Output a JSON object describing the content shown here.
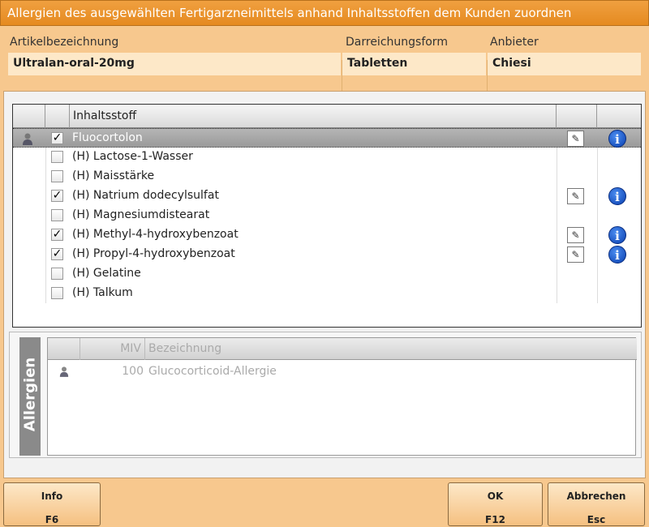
{
  "window": {
    "title": "Allergien des ausgewählten Fertigarzneimittels anhand Inhaltsstoffen dem Kunden zuordnen"
  },
  "artikel": {
    "headers": {
      "bezeichnung": "Artikelbezeichnung",
      "darreichung": "Darreichungsform",
      "anbieter": "Anbieter"
    },
    "values": {
      "bezeichnung": "Ultralan-oral-20mg",
      "darreichung": "Tabletten",
      "anbieter": "Chiesi"
    }
  },
  "inhaltsstoffe": {
    "column_header": "Inhaltsstoff",
    "rows": [
      {
        "name": "Fluocortolon",
        "checked": true,
        "selected": true,
        "person_icon": true,
        "pen_icon": true,
        "info_icon": true
      },
      {
        "name": "(H) Lactose-1-Wasser",
        "checked": false,
        "selected": false,
        "person_icon": false,
        "pen_icon": false,
        "info_icon": false
      },
      {
        "name": "(H) Maisstärke",
        "checked": false,
        "selected": false,
        "person_icon": false,
        "pen_icon": false,
        "info_icon": false
      },
      {
        "name": "(H) Natrium dodecylsulfat",
        "checked": true,
        "selected": false,
        "person_icon": false,
        "pen_icon": true,
        "info_icon": true
      },
      {
        "name": "(H) Magnesiumdistearat",
        "checked": false,
        "selected": false,
        "person_icon": false,
        "pen_icon": false,
        "info_icon": false
      },
      {
        "name": "(H) Methyl-4-hydroxybenzoat",
        "checked": true,
        "selected": false,
        "person_icon": false,
        "pen_icon": true,
        "info_icon": true
      },
      {
        "name": "(H) Propyl-4-hydroxybenzoat",
        "checked": true,
        "selected": false,
        "person_icon": false,
        "pen_icon": true,
        "info_icon": true
      },
      {
        "name": "(H) Gelatine",
        "checked": false,
        "selected": false,
        "person_icon": false,
        "pen_icon": false,
        "info_icon": false
      },
      {
        "name": "(H) Talkum",
        "checked": false,
        "selected": false,
        "person_icon": false,
        "pen_icon": false,
        "info_icon": false
      }
    ]
  },
  "allergien": {
    "label": "Allergien",
    "headers": {
      "miv": "MIV",
      "bezeichnung": "Bezeichnung"
    },
    "rows": [
      {
        "miv": "100",
        "bezeichnung": "Glucocorticoid-Allergie"
      }
    ]
  },
  "buttons": {
    "info": {
      "label": "Info",
      "key": "F6"
    },
    "ok": {
      "label": "OK",
      "key": "F12"
    },
    "abbrechen": {
      "label": "Abbrechen",
      "key": "Esc"
    }
  },
  "icons": {
    "person": "person-icon",
    "pen": "pen-icon",
    "info": "info-icon",
    "check": "check-icon"
  },
  "colors": {
    "titlebar": "#e58a20",
    "background": "#f7c88e",
    "info_blue": "#0a3faf",
    "selected_row": "#a8a8a8"
  }
}
